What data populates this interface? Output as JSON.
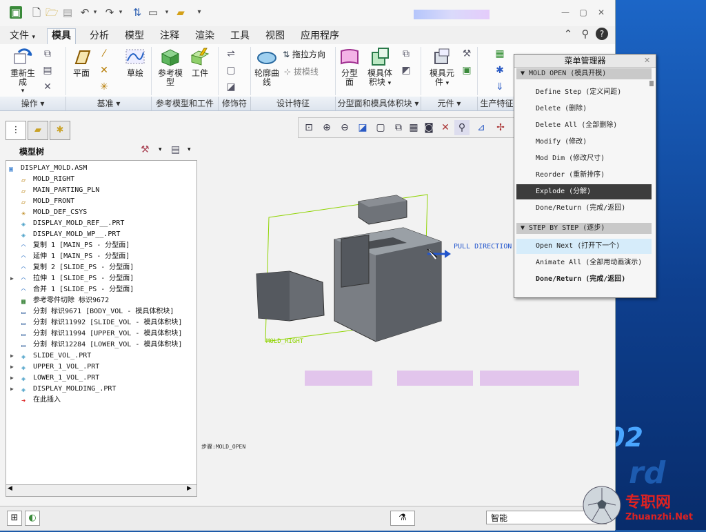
{
  "quick_access": {
    "icons": [
      "app-icon",
      "new-icon",
      "open-icon",
      "save-icon",
      "undo-icon",
      "redo-icon",
      "regenerate-icon",
      "window-icon",
      "folder-icon",
      "more-icon"
    ]
  },
  "tabs": [
    {
      "label": "文件",
      "dropdown": "▾"
    },
    {
      "label": "模具"
    },
    {
      "label": "分析"
    },
    {
      "label": "模型"
    },
    {
      "label": "注释"
    },
    {
      "label": "渲染"
    },
    {
      "label": "工具"
    },
    {
      "label": "视图"
    },
    {
      "label": "应用程序"
    }
  ],
  "ribbon": {
    "regen": "重新生成",
    "plane": "平面",
    "sketch": "草绘",
    "ref_model": "参考模型",
    "workpiece": "工件",
    "drag_dir": "拖拉方向",
    "draft_line": "拔模线",
    "contour": "轮廓曲线",
    "parting": "分型面",
    "mold_vol": "模具体积块",
    "mold_comp": "模具元件",
    "groups": [
      "操作 ▾",
      "基准 ▾",
      "参考模型和工件",
      "修饰符",
      "设计特征",
      "分型面和模具体积块 ▾",
      "元件 ▾",
      "生产特征"
    ]
  },
  "tree": {
    "title": "模型树",
    "items": [
      {
        "label": "DISPLAY_MOLD.ASM",
        "icon": "assembly-icon",
        "indent": 0
      },
      {
        "label": "MOLD_RIGHT",
        "icon": "datum-plane-icon",
        "indent": 1
      },
      {
        "label": "MAIN_PARTING_PLN",
        "icon": "datum-plane-icon",
        "indent": 1
      },
      {
        "label": "MOLD_FRONT",
        "icon": "datum-plane-icon",
        "indent": 1
      },
      {
        "label": "MOLD_DEF_CSYS",
        "icon": "csys-icon",
        "indent": 1
      },
      {
        "label": "DISPLAY_MOLD_REF__.PRT",
        "icon": "part-icon",
        "indent": 1
      },
      {
        "label": "DISPLAY_MOLD_WP__.PRT",
        "icon": "part-icon",
        "indent": 1
      },
      {
        "label": "复制 1 [MAIN_PS - 分型面]",
        "icon": "surface-icon",
        "indent": 1
      },
      {
        "label": "延伸 1 [MAIN_PS - 分型面]",
        "icon": "surface-icon",
        "indent": 1
      },
      {
        "label": "复制 2 [SLIDE_PS - 分型面]",
        "icon": "surface-icon",
        "indent": 1
      },
      {
        "label": "拉伸 1 [SLIDE_PS - 分型面]",
        "icon": "surface-icon",
        "indent": 1,
        "expand": true
      },
      {
        "label": "合并 1 [SLIDE_PS - 分型面]",
        "icon": "surface-icon",
        "indent": 1
      },
      {
        "label": "参考零件切除 标识9672",
        "icon": "cut-icon",
        "indent": 1
      },
      {
        "label": "分割 标识9671 [BODY_VOL - 模具体积块]",
        "icon": "volume-icon",
        "indent": 1
      },
      {
        "label": "分割 标识11992 [SLIDE_VOL - 模具体积块]",
        "icon": "volume-icon",
        "indent": 1
      },
      {
        "label": "分割 标识11994 [UPPER_VOL - 模具体积块]",
        "icon": "volume-icon",
        "indent": 1
      },
      {
        "label": "分割 标识12284 [LOWER_VOL - 模具体积块]",
        "icon": "volume-icon",
        "indent": 1
      },
      {
        "label": "SLIDE_VOL_.PRT",
        "icon": "part-icon",
        "indent": 1,
        "expand": true
      },
      {
        "label": "UPPER_1_VOL_.PRT",
        "icon": "part-icon",
        "indent": 1,
        "expand": true
      },
      {
        "label": "LOWER_1_VOL_.PRT",
        "icon": "part-icon",
        "indent": 1,
        "expand": true
      },
      {
        "label": "DISPLAY_MOLDING_.PRT",
        "icon": "part-icon",
        "indent": 1,
        "expand": true
      },
      {
        "label": "在此插入",
        "icon": "insert-arrow-icon",
        "indent": 1
      }
    ]
  },
  "graphics": {
    "pull_direction": "PULL DIRECTION",
    "datum_label": "MOLD_RIGHT",
    "step_label": "步骤:MOLD_OPEN"
  },
  "menu_manager": {
    "title": "菜单管理器",
    "mold_open_header": "▼ MOLD OPEN (模具开模)",
    "items": [
      {
        "label": "Define Step (定义间距)"
      },
      {
        "label": "Delete (删除)"
      },
      {
        "label": "Delete All (全部删除)"
      },
      {
        "label": "Modify (修改)"
      },
      {
        "label": "Mod Dim (修改尺寸)"
      },
      {
        "label": "Reorder (重新排序)"
      },
      {
        "label": "Explode (分解)",
        "state": "selected"
      },
      {
        "label": "Done/Return (完成/返回)"
      }
    ],
    "step_header": "▼ STEP BY STEP (逐步)",
    "step_items": [
      {
        "label": "Open Next (打开下一个)",
        "state": "highlight"
      },
      {
        "label": "Animate All (全部用动画演示)"
      },
      {
        "label": "Done/Return (完成/返回)",
        "state": "bold"
      }
    ]
  },
  "status": {
    "filter": "智能"
  },
  "watermark": {
    "cn": "专职网",
    "en": "Zhuanzhi.Net"
  },
  "colors": {
    "accent": "#3c3c3c",
    "datum_green": "#8fd400",
    "pull_blue": "#2255cc",
    "model_gray": "#7a7e84"
  }
}
